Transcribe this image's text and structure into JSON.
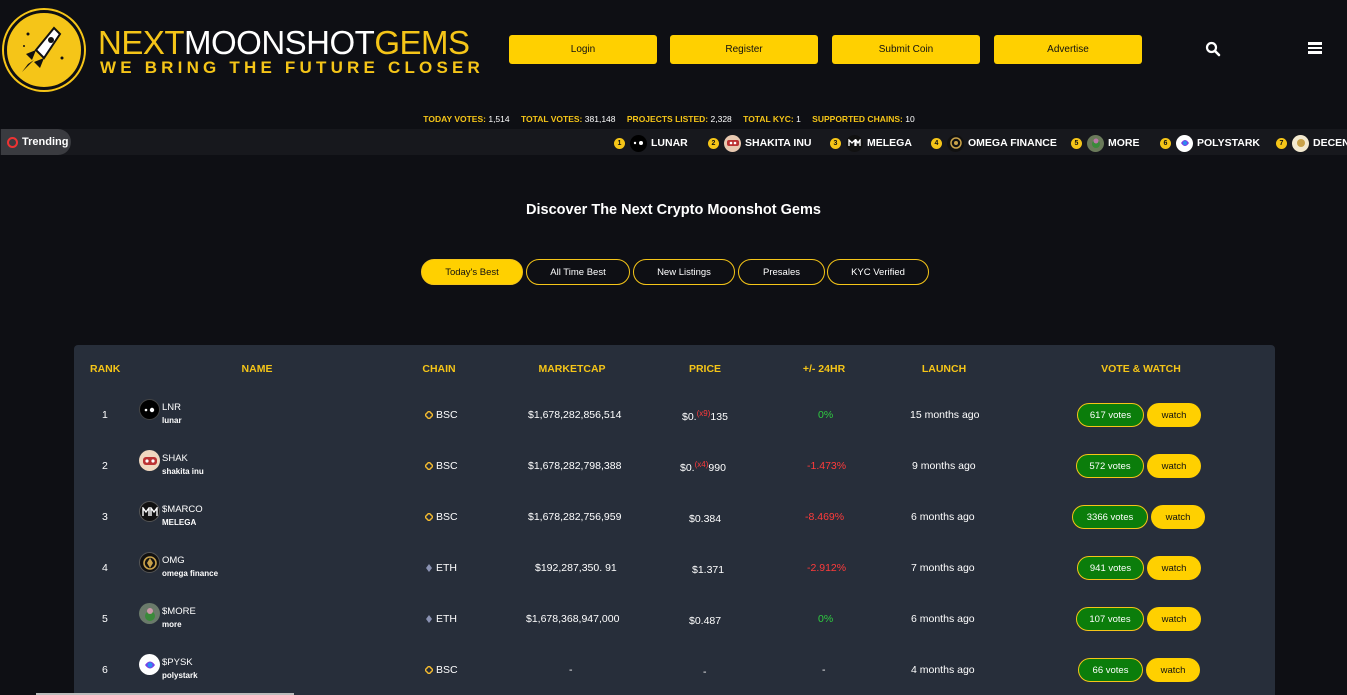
{
  "brand": {
    "word1": "NEXT",
    "word2": "MOONSHOT",
    "word3": "GEMS",
    "tagline": "WE BRING THE FUTURE CLOSER"
  },
  "nav": {
    "login": "Login",
    "register": "Register",
    "submit": "Submit Coin",
    "advertise": "Advertise"
  },
  "icons": {
    "search": "search-icon",
    "menu": "hamburger-menu-icon",
    "trending": "trending-icon"
  },
  "stats": {
    "today_votes_label": "TODAY VOTES:",
    "today_votes": "1,514",
    "total_votes_label": "TOTAL VOTES:",
    "total_votes": "381,148",
    "projects_label": "PROJECTS LISTED:",
    "projects": "2,328",
    "kyc_label": "TOTAL KYC:",
    "kyc": "1",
    "chains_label": "SUPPORTED CHAINS:",
    "chains": "10"
  },
  "trending": {
    "label": "Trending",
    "items": [
      {
        "num": "1",
        "name": "LUNAR"
      },
      {
        "num": "2",
        "name": "SHAKITA INU"
      },
      {
        "num": "3",
        "name": "MELEGA"
      },
      {
        "num": "4",
        "name": "OMEGA FINANCE"
      },
      {
        "num": "5",
        "name": "MORE"
      },
      {
        "num": "6",
        "name": "POLYSTARK"
      },
      {
        "num": "7",
        "name": "DECENT"
      }
    ]
  },
  "discover_title": "Discover The Next Crypto Moonshot Gems",
  "tabs": [
    "Today's Best",
    "All Time Best",
    "New Listings",
    "Presales",
    "KYC Verified"
  ],
  "table": {
    "headers": {
      "rank": "RANK",
      "name": "NAME",
      "chain": "CHAIN",
      "marketcap": "MARKETCAP",
      "price": "PRICE",
      "change": "+/- 24HR",
      "launch": "LAUNCH",
      "vote": "VOTE & WATCH"
    },
    "watch_label": "watch",
    "rows": [
      {
        "rank": "1",
        "symbol": "LNR",
        "name": "lunar",
        "chain": "BSC",
        "marketcap": "$1,678,282,856,514",
        "price_pre": "$0.",
        "price_sup": "(x9)",
        "price_post": "135",
        "change": "0%",
        "change_color": "green",
        "launch": "15 months ago",
        "votes": "617 votes"
      },
      {
        "rank": "2",
        "symbol": "SHAK",
        "name": "shakita inu",
        "chain": "BSC",
        "marketcap": "$1,678,282,798,388",
        "price_pre": "$0.",
        "price_sup": "(x4)",
        "price_post": "990",
        "change": "-1.473%",
        "change_color": "red",
        "launch": "9 months ago",
        "votes": "572 votes"
      },
      {
        "rank": "3",
        "symbol": "$MARCO",
        "name": "MELEGA",
        "chain": "BSC",
        "marketcap": "$1,678,282,756,959",
        "price_pre": "$0.384",
        "price_sup": "",
        "price_post": "",
        "change": "-8.469%",
        "change_color": "red",
        "launch": "6 months ago",
        "votes": "3366 votes"
      },
      {
        "rank": "4",
        "symbol": "OMG",
        "name": "omega finance",
        "chain": "ETH",
        "marketcap": "$192,287,350. 91",
        "price_pre": "$1.371",
        "price_sup": "",
        "price_post": "",
        "change": "-2.912%",
        "change_color": "red",
        "launch": "7 months ago",
        "votes": "941 votes"
      },
      {
        "rank": "5",
        "symbol": "$MORE",
        "name": "more",
        "chain": "ETH",
        "marketcap": "$1,678,368,947,000",
        "price_pre": "$0.487",
        "price_sup": "",
        "price_post": "",
        "change": "0%",
        "change_color": "green",
        "launch": "6 months ago",
        "votes": "107 votes"
      },
      {
        "rank": "6",
        "symbol": "$PYSK",
        "name": "polystark",
        "chain": "BSC",
        "marketcap": "-",
        "price_pre": "-",
        "price_sup": "",
        "price_post": "",
        "change": "-",
        "change_color": "white",
        "launch": "4 months ago",
        "votes": "66 votes"
      }
    ]
  },
  "colors": {
    "accent": "#ffd000",
    "background": "#0e0f14",
    "panel": "#272e3a",
    "vote_green": "#0b7d0b"
  }
}
